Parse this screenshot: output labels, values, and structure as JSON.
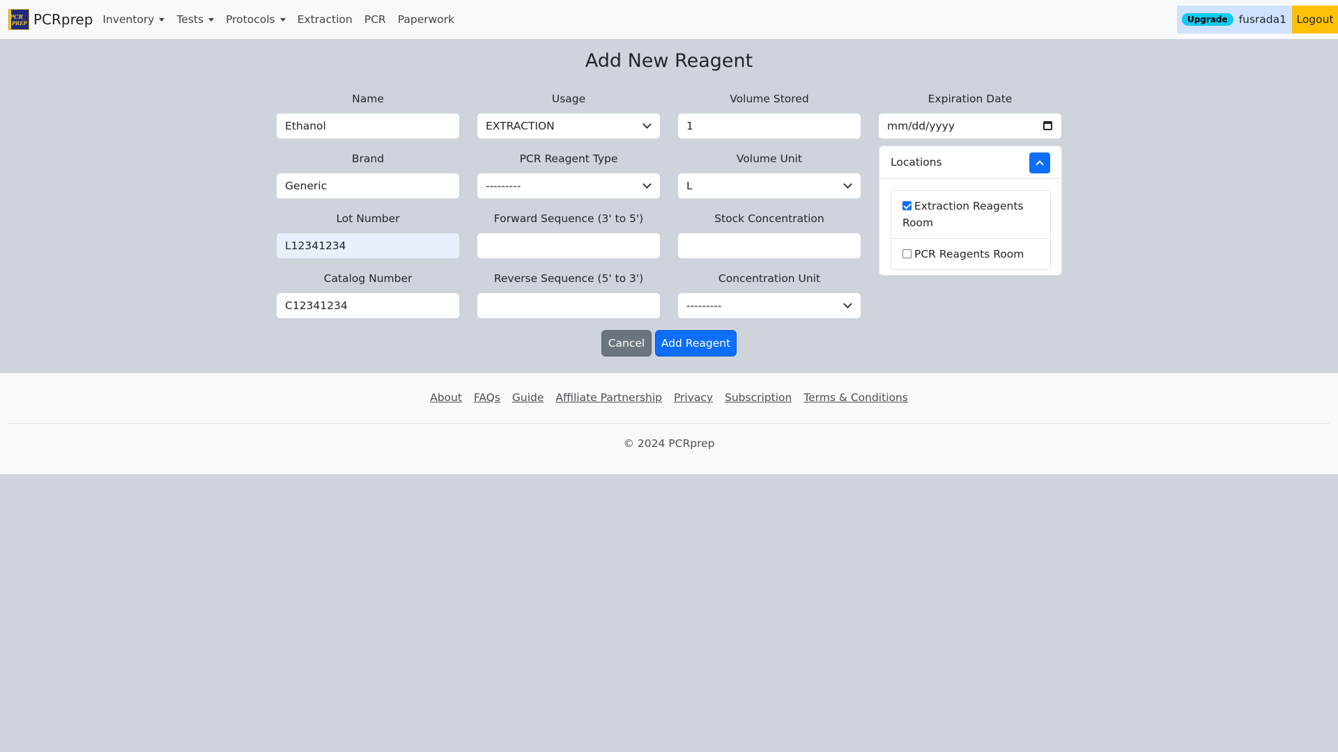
{
  "navbar": {
    "brand": "PCRprep",
    "logo_text_top": "PCR",
    "logo_text_bottom": "PREP",
    "links": [
      {
        "label": "Inventory",
        "dropdown": true
      },
      {
        "label": "Tests",
        "dropdown": true
      },
      {
        "label": "Protocols",
        "dropdown": true
      },
      {
        "label": "Extraction",
        "dropdown": false
      },
      {
        "label": "PCR",
        "dropdown": false
      },
      {
        "label": "Paperwork",
        "dropdown": false
      }
    ],
    "upgrade_badge": "Upgrade",
    "username": "fusrada1",
    "logout": "Logout"
  },
  "page": {
    "title": "Add New Reagent"
  },
  "form": {
    "name": {
      "label": "Name",
      "value": "Ethanol"
    },
    "brand": {
      "label": "Brand",
      "value": "Generic"
    },
    "lot_number": {
      "label": "Lot Number",
      "value": "L12341234"
    },
    "catalog_number": {
      "label": "Catalog Number",
      "value": "C12341234"
    },
    "usage": {
      "label": "Usage",
      "value": "EXTRACTION"
    },
    "pcr_reagent_type": {
      "label": "PCR Reagent Type",
      "value": "---------"
    },
    "forward_sequence": {
      "label": "Forward Sequence (3' to 5')",
      "value": ""
    },
    "reverse_sequence": {
      "label": "Reverse Sequence (5' to 3')",
      "value": ""
    },
    "volume_stored": {
      "label": "Volume Stored",
      "value": "1"
    },
    "volume_unit": {
      "label": "Volume Unit",
      "value": "L"
    },
    "stock_concentration": {
      "label": "Stock Concentration",
      "value": ""
    },
    "concentration_unit": {
      "label": "Concentration Unit",
      "value": "---------"
    },
    "expiration_date": {
      "label": "Expiration Date",
      "placeholder": "mm/dd/yyyy"
    },
    "locations": {
      "header": "Locations",
      "items": [
        {
          "label": "Extraction Reagents Room",
          "checked": true
        },
        {
          "label": "PCR Reagents Room",
          "checked": false
        }
      ]
    },
    "cancel_label": "Cancel",
    "submit_label": "Add Reagent"
  },
  "footer": {
    "links": [
      "About",
      "FAQs",
      "Guide",
      "Affiliate Partnership",
      "Privacy",
      "Subscription",
      "Terms & Conditions"
    ],
    "copyright": "© 2024 PCRprep"
  },
  "colors": {
    "primary": "#0d6efd",
    "secondary": "#6c757d",
    "warning": "#ffc107",
    "info": "#0dcaf0",
    "page_bg": "#cfd4dc"
  }
}
